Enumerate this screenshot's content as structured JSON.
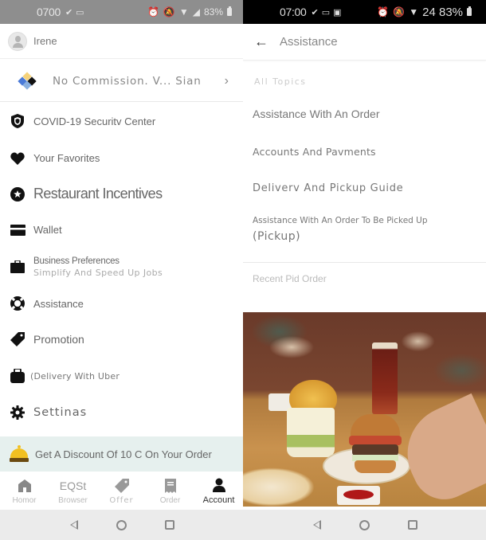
{
  "left": {
    "status_bar": {
      "time": "0700",
      "left_icons": [
        "check-icon",
        "laptop-icon"
      ],
      "battery": "83%",
      "right_icons": [
        "alarm-icon",
        "mute-icon",
        "wifi-icon",
        "signal-icon",
        "battery-icon"
      ]
    },
    "profile": {
      "name": "Irene"
    },
    "commission_banner": {
      "text": "No Commission. V... Sian",
      "chevron": "›"
    },
    "menu": [
      {
        "icon": "shield-icon",
        "label": "COVID-19 Securitv Center"
      },
      {
        "icon": "heart-icon",
        "label": "Your Favorites"
      },
      {
        "icon": "star-badge-icon",
        "label": "Restaurant Incentives"
      },
      {
        "icon": "wallet-icon",
        "label": "Wallet"
      },
      {
        "icon": "briefcase-icon",
        "label": "Business Preferences",
        "sublabel": "Simplify And Speed Up Jobs"
      },
      {
        "icon": "lifebuoy-icon",
        "label": "Assistance"
      },
      {
        "icon": "tag-icon",
        "label": "Promotion"
      },
      {
        "icon": "delivery-bag-icon",
        "label": "(Delivery With Uber"
      },
      {
        "icon": "gear-icon",
        "label": "Settinas"
      }
    ],
    "promo": {
      "text": "Get A Discount Of 10 C On Your Order",
      "icon": "food-bell-icon"
    },
    "bottom_nav": [
      {
        "icon": "home-icon",
        "label": "Homor",
        "active": false
      },
      {
        "icon": "browse-icon",
        "icon_text": "EQSt",
        "label": "Browser",
        "active": false
      },
      {
        "icon": "offers-tag-icon",
        "label": "Offer",
        "active": false
      },
      {
        "icon": "receipt-icon",
        "label": "Order",
        "active": false
      },
      {
        "icon": "account-icon",
        "label": "Account",
        "active": true
      }
    ]
  },
  "right": {
    "status_bar": {
      "time": "07:00",
      "left_icons": [
        "check-icon",
        "laptop-icon",
        "image-icon"
      ],
      "battery": "24 83%",
      "right_icons": [
        "alarm-icon",
        "mute-icon",
        "wifi-icon",
        "battery-icon"
      ]
    },
    "header": {
      "title": "Assistance",
      "back_icon": "←"
    },
    "topics_header": "All Topics",
    "topics": [
      "Assistance With An Order",
      "Accounts And Pavments",
      "Deliverv And Pickup Guide"
    ],
    "pickup_topic": {
      "line1": "Assistance With An Order To Be Picked Up",
      "line2": "(Pickup)"
    },
    "recent_label": "Recent Pid Order",
    "photo_alt": "Burger with fries and beer on a restaurant table"
  },
  "colors": {
    "left_status_bg": "#8e8e8e",
    "right_status_bg": "#000000",
    "promo_bg": "#e6f0ee",
    "sysnav_bg": "#ebebeb",
    "icon_dark": "#111111",
    "text_gray": "#666666"
  }
}
